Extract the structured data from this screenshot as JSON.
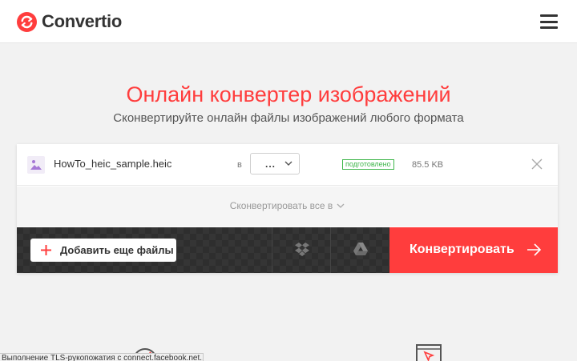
{
  "app": {
    "name": "Convertio",
    "brand_color": "#ff3d3d"
  },
  "header": {
    "menu_icon": "hamburger-menu-icon"
  },
  "hero": {
    "title": "Онлайн конвертер изображений",
    "subtitle": "Сконвертируйте онлайн файлы изображений любого формата"
  },
  "file": {
    "name": "HowTo_heic_sample.heic",
    "to_label": "в",
    "format_value": "...",
    "status": "подготовлено",
    "status_color": "#3fb64b",
    "size": "85.5 KB"
  },
  "convert_all": {
    "label": "Сконвертировать все в"
  },
  "actions": {
    "add_files_label": "Добавить еще файлы",
    "dropbox_icon": "dropbox-icon",
    "gdrive_icon": "google-drive-icon",
    "convert_label": "Конвертировать"
  },
  "browser_status": {
    "text": "Выполнение TLS-рукопожатия с connect.facebook.net..."
  }
}
